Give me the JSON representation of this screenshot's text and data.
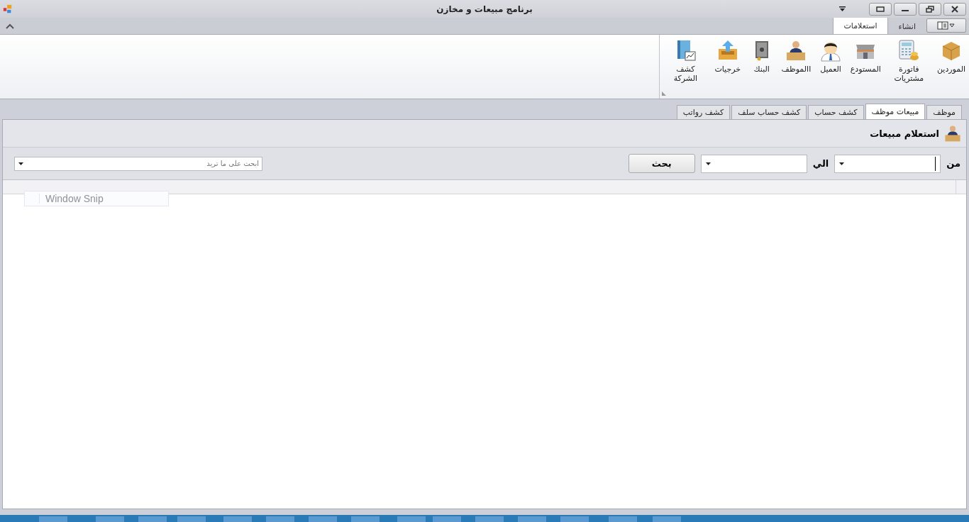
{
  "window": {
    "title": "برنامج مبيعات و مخازن"
  },
  "ribbon": {
    "tabs": [
      {
        "label": "انشاء",
        "selected": false
      },
      {
        "label": "استعلامات",
        "selected": true
      }
    ],
    "buttons": [
      {
        "label": "الموردين",
        "kind": "box"
      },
      {
        "label": "فاتورة مشتريات",
        "kind": "calculator"
      },
      {
        "label": "المستودع",
        "kind": "store"
      },
      {
        "label": "العميل",
        "kind": "customer"
      },
      {
        "label": "االموظف",
        "kind": "employee"
      },
      {
        "label": "البنك",
        "kind": "safe"
      },
      {
        "label": "خرجيات",
        "kind": "outbox"
      },
      {
        "label": "كشف الشركة",
        "kind": "ledger"
      }
    ]
  },
  "document_tabs": [
    {
      "label": "موظف",
      "selected": false
    },
    {
      "label": "مبيعات موظف",
      "selected": true
    },
    {
      "label": "كشف حساب",
      "selected": false
    },
    {
      "label": "كشف حساب سلف",
      "selected": false
    },
    {
      "label": "كشف رواتب",
      "selected": false
    }
  ],
  "panel": {
    "title": "استعلام مبيعات",
    "from_label": "من",
    "to_label": "الي",
    "search_button": "بحث",
    "search_field": {
      "placeholder": "ابحث على ما تريد"
    }
  },
  "tooltip": {
    "label": "Window Snip"
  }
}
